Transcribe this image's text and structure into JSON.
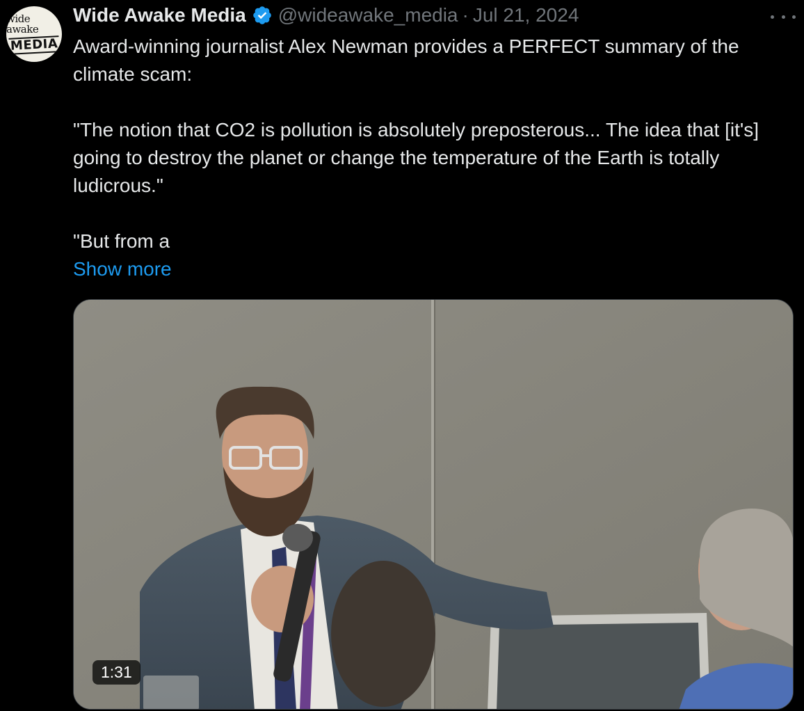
{
  "author": {
    "display_name": "Wide Awake Media",
    "handle": "@wideawake_media",
    "separator": "·",
    "date": "Jul 21, 2024",
    "verified_color": "#1d9bf0",
    "avatar_logo": {
      "top": "wide awake",
      "bottom": "MEDIA"
    }
  },
  "tweet": {
    "paragraphs": [
      "Award-winning journalist Alex Newman provides a PERFECT summary of the climate scam:",
      "\"The notion that CO2 is pollution is absolutely preposterous... The idea that [it's] going to destroy the planet or change the temperature of the Earth is totally ludicrous.\"",
      "\"But from a"
    ],
    "show_more": "Show more"
  },
  "media": {
    "type": "video",
    "duration": "1:31"
  },
  "colors": {
    "background": "#000000",
    "text": "#e7e9ea",
    "secondary": "#71767b",
    "link": "#1d9bf0"
  },
  "icons": [
    "verified-badge-icon",
    "more-options-icon"
  ]
}
